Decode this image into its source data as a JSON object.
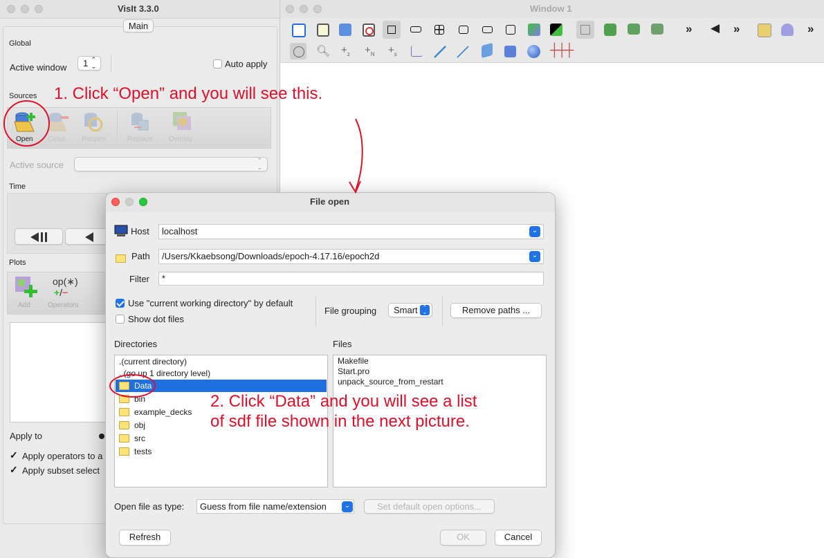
{
  "visit": {
    "title": "VisIt 3.3.0",
    "tab_main": "Main",
    "global_label": "Global",
    "active_window_label": "Active window",
    "active_window_value": "1",
    "auto_apply": "Auto apply",
    "sources_label": "Sources",
    "sources_buttons": [
      "Open",
      "Close",
      "Reopen",
      "Replace",
      "Overlay"
    ],
    "active_source_label": "Active source",
    "time_label": "Time",
    "plots_label": "Plots",
    "plots_buttons": [
      "Add",
      "Operators"
    ],
    "operators_glyph": "op(∗)",
    "apply_to_label": "Apply to",
    "apply_operators": "Apply operators to a",
    "apply_subset": "Apply subset select"
  },
  "window1": {
    "title": "Window 1"
  },
  "dialog": {
    "title": "File open",
    "host_label": "Host",
    "host_value": "localhost",
    "path_label": "Path",
    "path_value": "/Users/Kkaebsong/Downloads/epoch-4.17.16/epoch2d",
    "filter_label": "Filter",
    "filter_value": "*",
    "use_cwd": "Use \"current working directory\" by default",
    "show_dot": "Show dot files",
    "file_grouping_label": "File grouping",
    "file_grouping_value": "Smart",
    "remove_paths": "Remove paths ...",
    "directories_label": "Directories",
    "files_label": "Files",
    "directories": [
      ".(current directory)",
      "..(go up 1 directory level)",
      "Data",
      "bin",
      "example_decks",
      "obj",
      "src",
      "tests"
    ],
    "files": [
      "Makefile",
      "Start.pro",
      "unpack_source_from_restart"
    ],
    "open_as_label": "Open file as type:",
    "open_as_value": "Guess from file name/extension",
    "set_default": "Set default open options...",
    "refresh": "Refresh",
    "ok": "OK",
    "cancel": "Cancel"
  },
  "annotations": {
    "step1": "1. Click “Open” and you will see this.",
    "step2_line1": "2. Click “Data” and you will see a list",
    "step2_line2": "of sdf file shown in the next picture."
  },
  "colors": {
    "accent": "#1f73e6",
    "annotation": "#e0102a",
    "selection": "#1f6fe0"
  }
}
